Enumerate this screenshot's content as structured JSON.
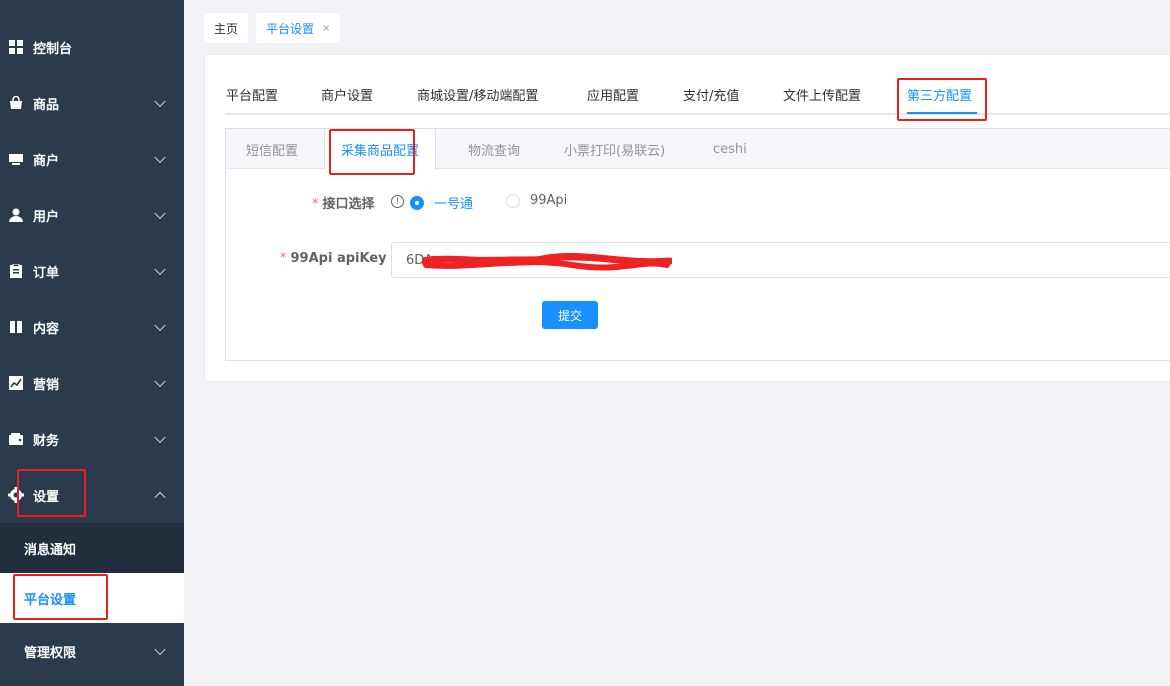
{
  "sidebar": {
    "items": [
      {
        "label": "控制台",
        "icon": "dashboard-icon"
      },
      {
        "label": "商品",
        "icon": "shopping-bag-icon"
      },
      {
        "label": "商户",
        "icon": "store-icon"
      },
      {
        "label": "用户",
        "icon": "user-icon"
      },
      {
        "label": "订单",
        "icon": "clipboard-icon"
      },
      {
        "label": "内容",
        "icon": "book-icon"
      },
      {
        "label": "营销",
        "icon": "chart-icon"
      },
      {
        "label": "财务",
        "icon": "wallet-icon"
      },
      {
        "label": "设置",
        "icon": "gear-icon"
      }
    ],
    "submenu": [
      "消息通知",
      "平台设置"
    ],
    "bottom_item": "管理权限"
  },
  "tagbar": {
    "tags": [
      "主页",
      "平台设置"
    ],
    "close_glyph": "×"
  },
  "tabs": [
    "平台配置",
    "商户设置",
    "商城设置/移动端配置",
    "应用配置",
    "支付/充值",
    "文件上传配置",
    "第三方配置"
  ],
  "active_tab": "第三方配置",
  "subtabs": [
    "短信配置",
    "采集商品配置",
    "物流查询",
    "小票打印(易联云)",
    "ceshi"
  ],
  "active_subtab": "采集商品配置",
  "form": {
    "required_mark": "*",
    "interface_label": "接口选择",
    "info_glyph": "!",
    "options": [
      "一号通",
      "99Api"
    ],
    "selected_option": "一号通",
    "apikey_label": "99Api apiKey",
    "apikey_value": "6DA",
    "submit_label": "提交"
  },
  "colors": {
    "sidebar_bg": "#2c3a4e",
    "accent": "#1890ff",
    "highlight_box": "#e6201c",
    "redaction": "#ee2222"
  }
}
